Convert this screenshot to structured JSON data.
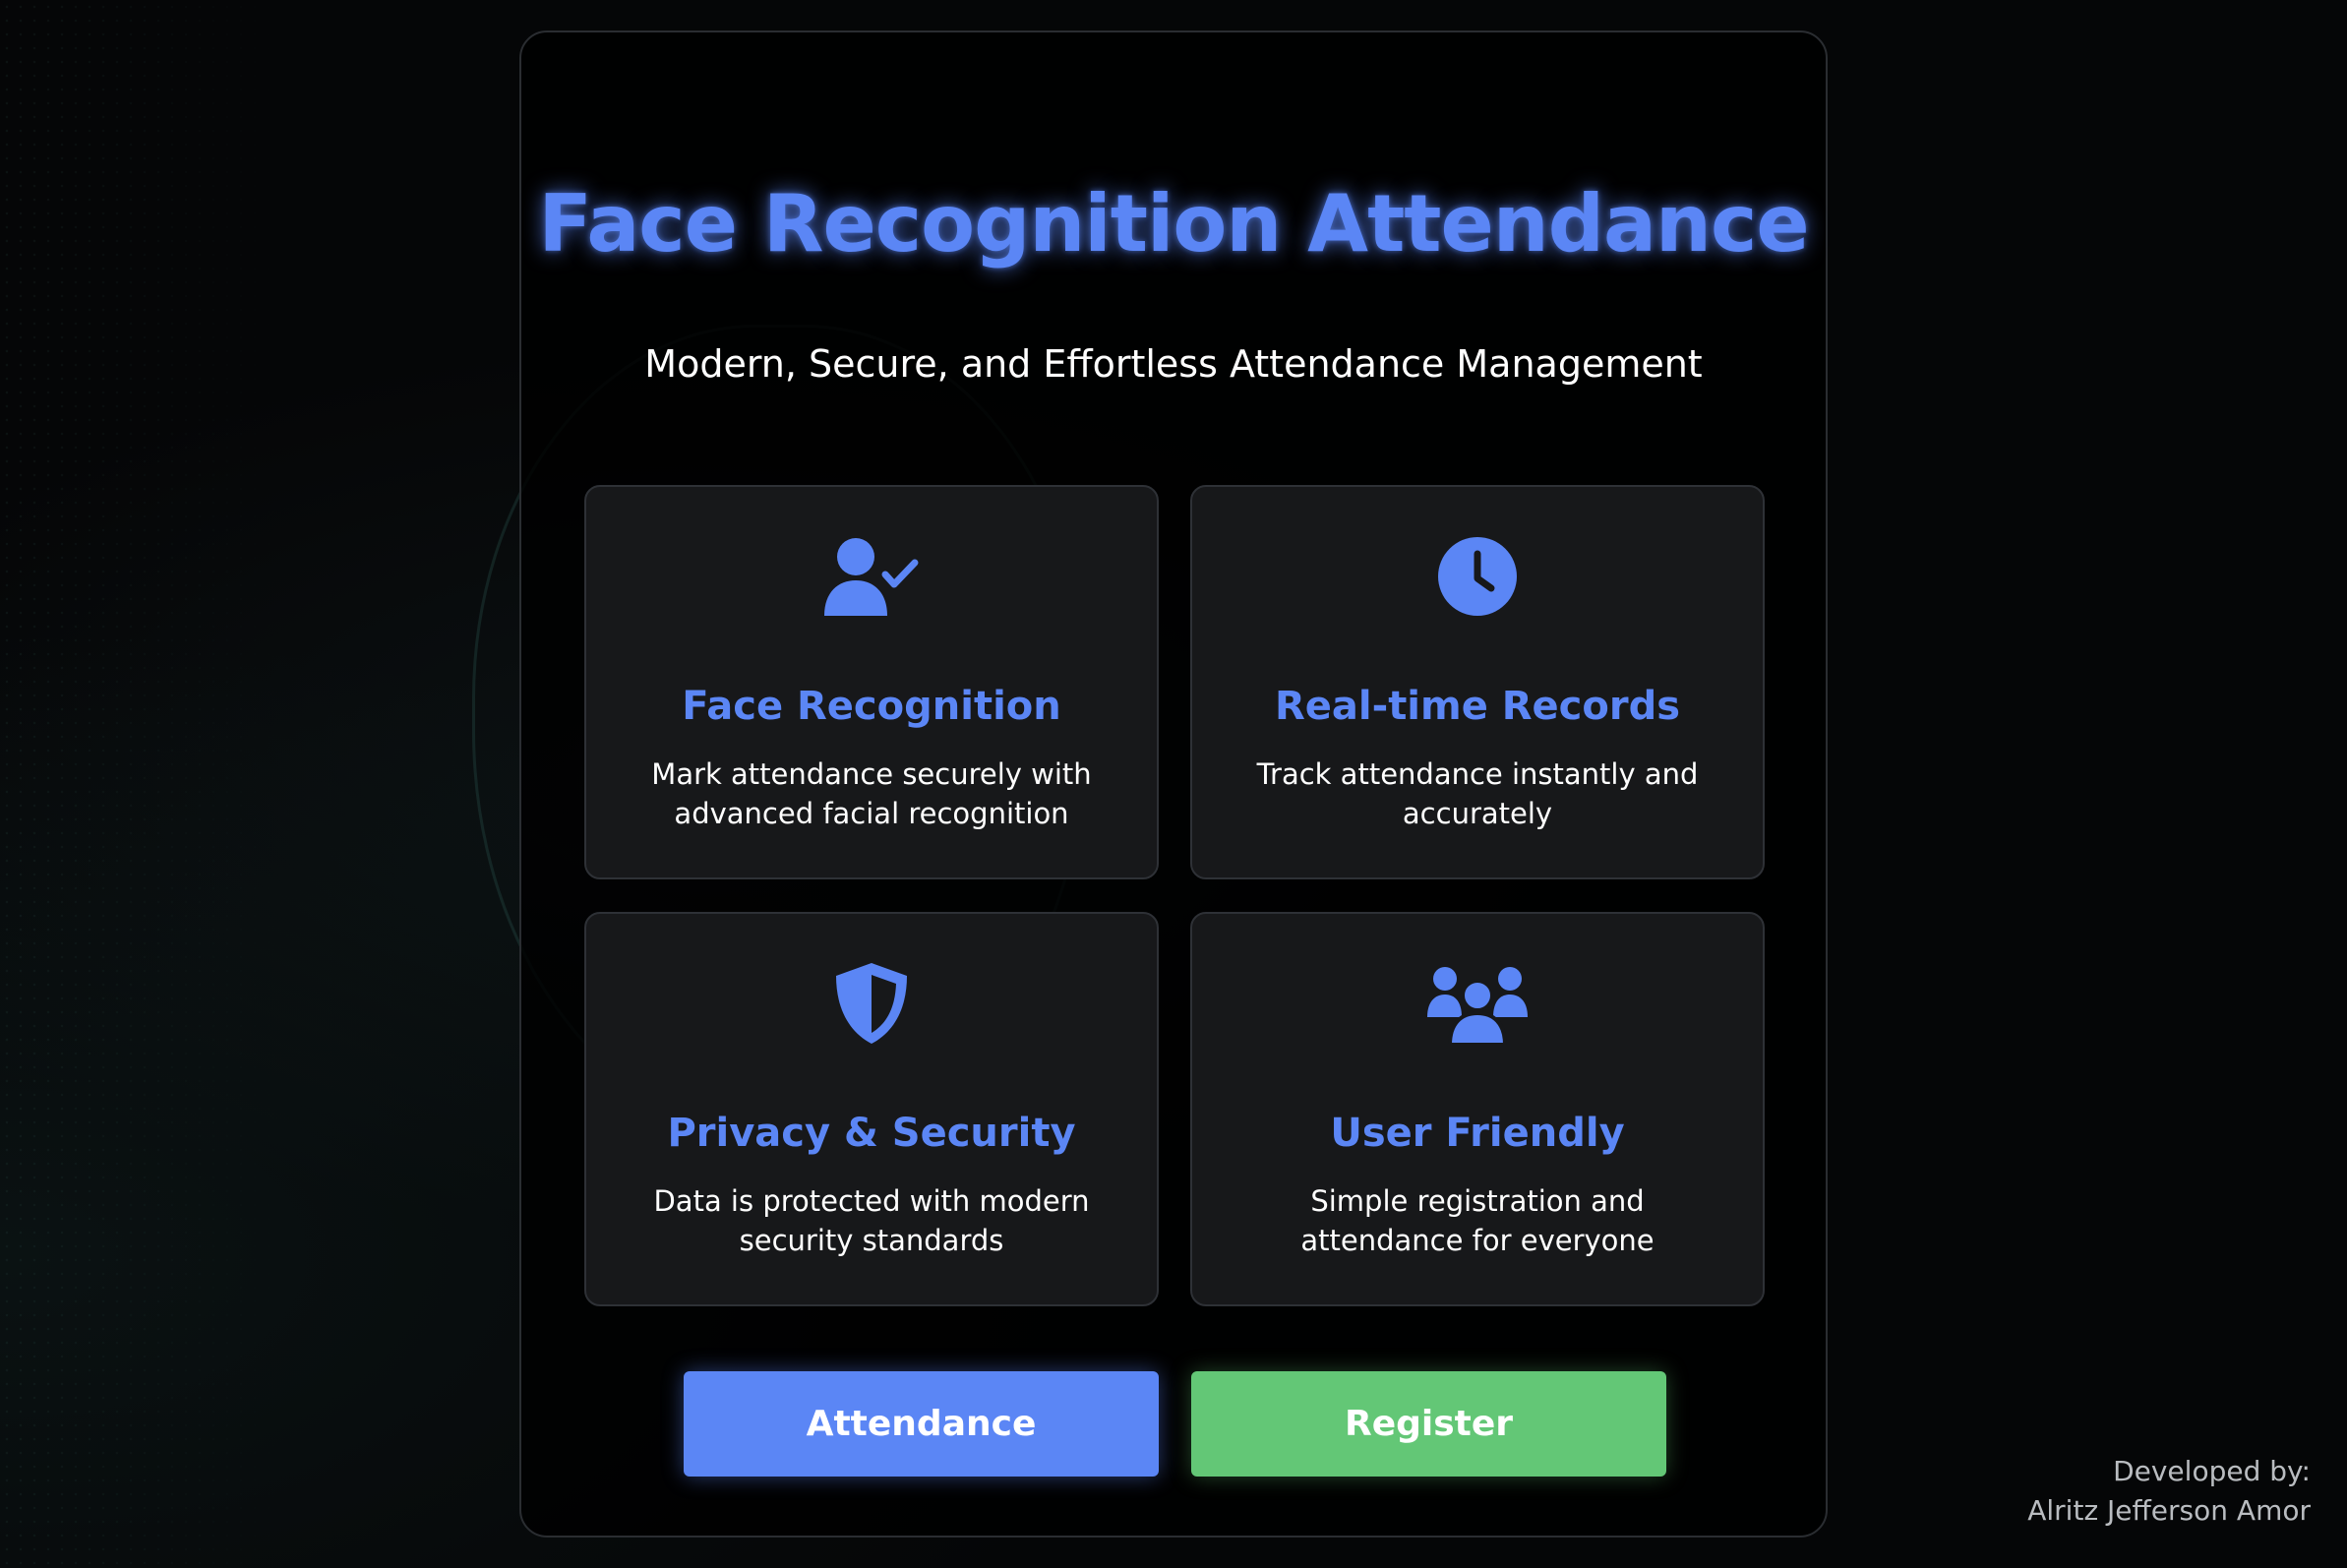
{
  "header": {
    "title": "Face Recognition Attendance",
    "subtitle": "Modern, Secure, and Effortless Attendance Management"
  },
  "features": [
    {
      "icon": "user-check-icon",
      "title": "Face Recognition",
      "description": "Mark attendance securely with advanced facial recognition"
    },
    {
      "icon": "clock-icon",
      "title": "Real-time Records",
      "description": "Track attendance instantly and accurately"
    },
    {
      "icon": "shield-icon",
      "title": "Privacy & Security",
      "description": "Data is protected with modern security standards"
    },
    {
      "icon": "users-icon",
      "title": "User Friendly",
      "description": "Simple registration and attendance for everyone"
    }
  ],
  "actions": {
    "attendance_label": "Attendance",
    "register_label": "Register"
  },
  "footer": {
    "developed_by_label": "Developed by:",
    "developer_name": "Alritz Jefferson Amor"
  },
  "colors": {
    "accent_blue": "#5b86f5",
    "accent_green": "#63c776",
    "card_bg": "#17181a",
    "page_bg": "#050607"
  }
}
